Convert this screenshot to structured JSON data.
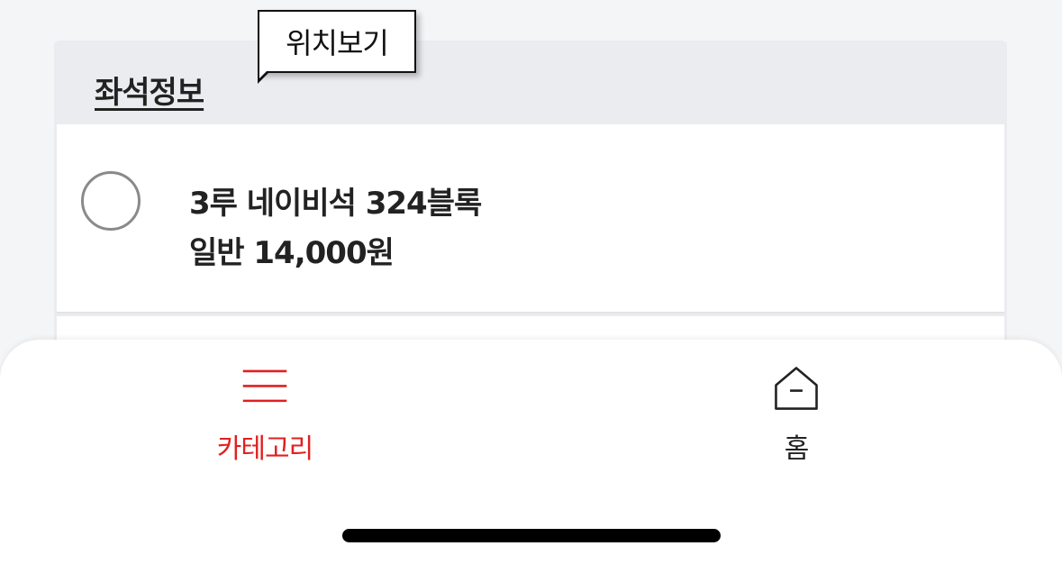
{
  "seat_info": {
    "title": "좌석정보",
    "tooltip": "위치보기",
    "seat": {
      "location": "3루 네이비석 324블록",
      "price_line": "일반 14,000원"
    }
  },
  "bottom_nav": {
    "items": [
      {
        "label": "카테고리",
        "icon": "menu-icon",
        "color": "#e02020"
      },
      {
        "label": "홈",
        "icon": "home-icon",
        "color": "#222222"
      }
    ]
  }
}
